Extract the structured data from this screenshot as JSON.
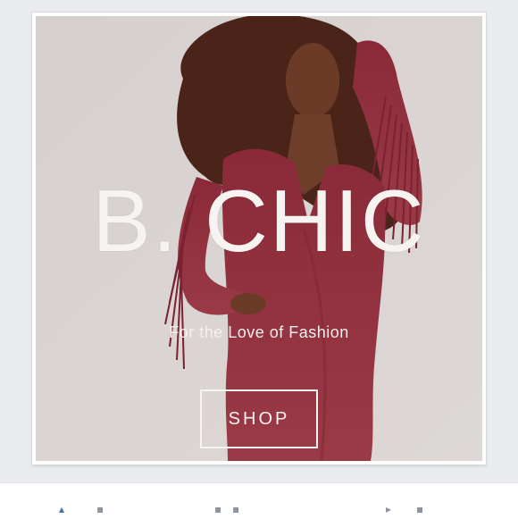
{
  "hero": {
    "brand": "B. CHIC",
    "tagline": "For the Love of Fashion",
    "button_label": "SHOP"
  },
  "colors": {
    "dress": "#8e2f3d",
    "background": "#d8d2cf",
    "text": "#f7f3f1"
  },
  "bottom_bar": {
    "icons": [
      "like-icon",
      "comment-icon",
      "share-icon",
      "send-icon"
    ]
  }
}
